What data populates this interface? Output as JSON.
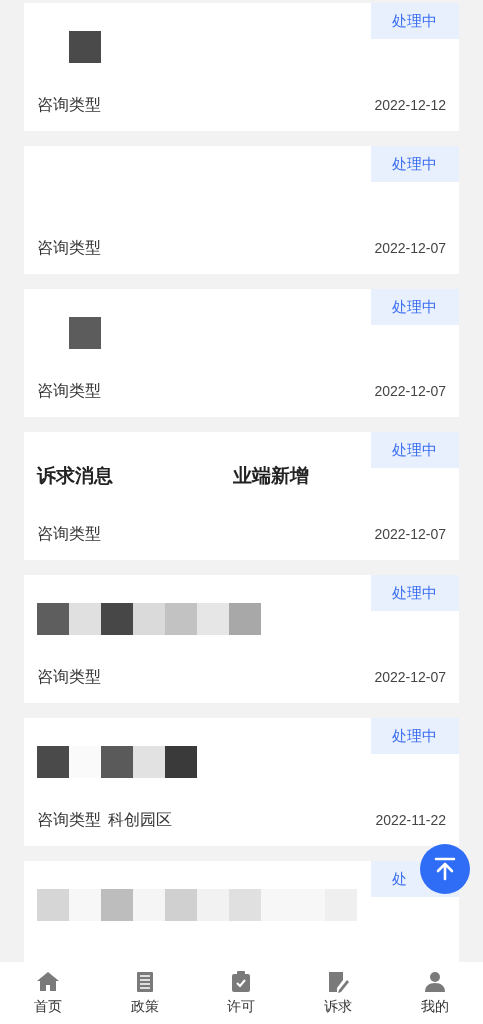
{
  "cards": [
    {
      "status": "处理中",
      "title_redacted": true,
      "tags": [
        "咨询类型"
      ],
      "date": "2022-12-12"
    },
    {
      "status": "处理中",
      "tags": [
        "咨询类型"
      ],
      "date": "2022-12-07"
    },
    {
      "status": "处理中",
      "title_redacted": true,
      "tags": [
        "咨询类型"
      ],
      "date": "2022-12-07"
    },
    {
      "status": "处理中",
      "title_segments": [
        "诉求消息",
        "业端新增"
      ],
      "tags": [
        "咨询类型"
      ],
      "date": "2022-12-07"
    },
    {
      "status": "处理中",
      "title_redacted": true,
      "tags": [
        "咨询类型"
      ],
      "date": "2022-12-07"
    },
    {
      "status": "处理中",
      "title_redacted": true,
      "tags": [
        "咨询类型",
        "科创园区"
      ],
      "date": "2022-11-22"
    },
    {
      "status": "处",
      "title_redacted": true
    }
  ],
  "tabbar": [
    {
      "label": "首页",
      "kind": "home"
    },
    {
      "label": "政策",
      "kind": "list"
    },
    {
      "label": "许可",
      "kind": "clipboard"
    },
    {
      "label": "诉求",
      "kind": "edit"
    },
    {
      "label": "我的",
      "kind": "user"
    }
  ]
}
